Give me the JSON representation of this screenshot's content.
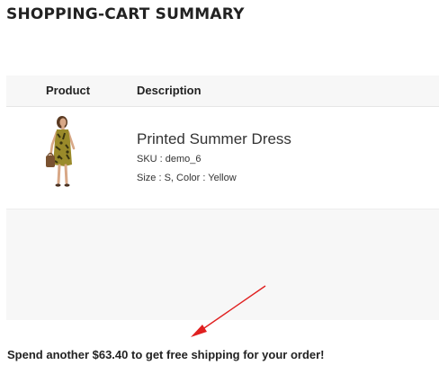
{
  "page": {
    "title": "SHOPPING-CART SUMMARY"
  },
  "table": {
    "headers": {
      "product": "Product",
      "description": "Description"
    },
    "items": [
      {
        "name": "Printed Summer Dress",
        "sku": "SKU : demo_6",
        "attributes": "Size : S, Color : Yellow",
        "image_icon": "dress-model-photo"
      }
    ]
  },
  "shipping": {
    "message": "Spend another $63.40 to get free shipping for your order!"
  },
  "colors": {
    "annotation_arrow": "#e02020",
    "panel_background": "#f7f7f7"
  }
}
